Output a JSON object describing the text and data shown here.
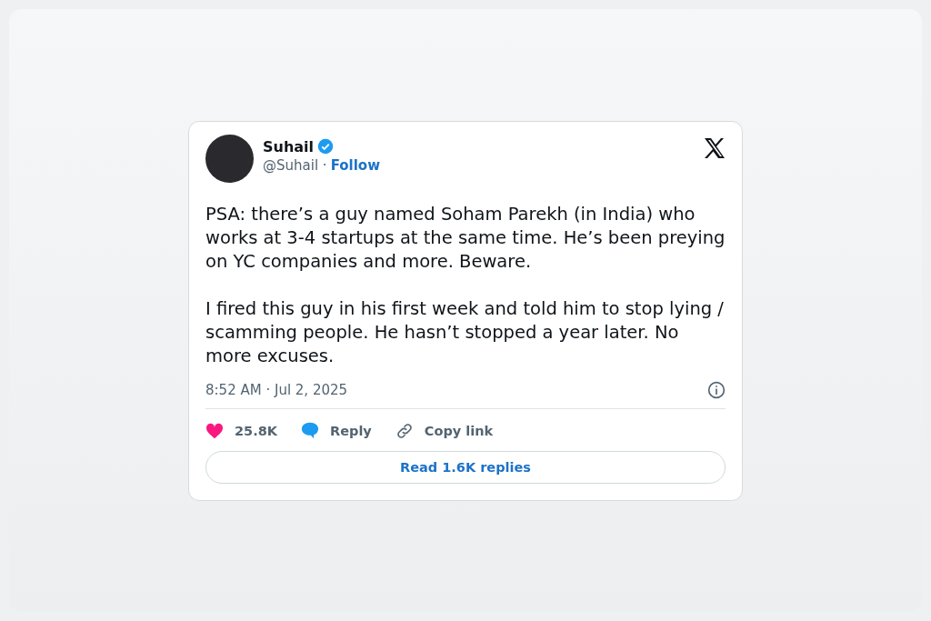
{
  "tweet": {
    "author": {
      "name": "Suhail",
      "verified": true,
      "handle": "@Suhail",
      "separator": "·",
      "follow": "Follow"
    },
    "paragraphs": [
      "PSA: there’s a guy named Soham Parekh (in India) who works at 3-4 startups at the same time. He’s been preying on YC companies and more. Beware.",
      "I fired this guy in his first week and told him to stop lying / scamming people. He hasn’t stopped a year later. No more excuses."
    ],
    "timestamp": "8:52 AM · Jul 2, 2025",
    "actions": [
      {
        "kind": "like",
        "label": "25.8K"
      },
      {
        "kind": "reply",
        "label": "Reply"
      },
      {
        "kind": "copy",
        "label": "Copy link"
      }
    ],
    "read_replies": "Read 1.6K replies"
  }
}
